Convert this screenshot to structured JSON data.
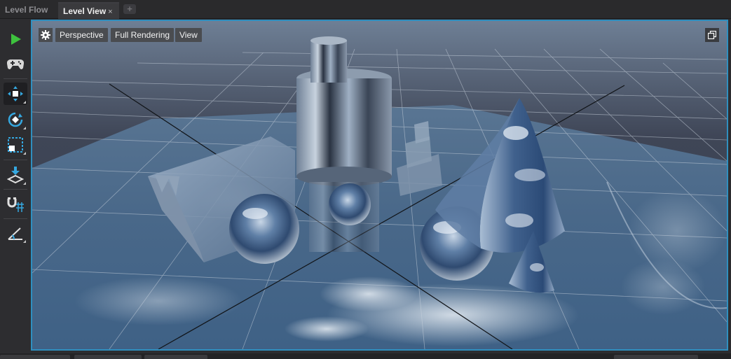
{
  "tabs": [
    {
      "label": "Level Flow"
    },
    {
      "label": "Level View",
      "close": "×"
    }
  ],
  "add_tab": "+",
  "toolbar": {
    "tools": [
      "play-icon",
      "gamepad-icon",
      "move-icon",
      "rotate-icon",
      "scale-select-icon",
      "drop-to-floor-icon",
      "snap-grid-icon",
      "angle-snap-icon"
    ],
    "active": "move-icon"
  },
  "viewport": {
    "buttons": {
      "perspective": "Perspective",
      "rendering": "Full Rendering",
      "view": "View"
    },
    "settings_icon": "gear-icon",
    "maximize_icon": "restore-window-icon"
  },
  "colors": {
    "accent_border": "#2f8fbf",
    "play_green": "#3ec23e",
    "tool_blue": "#35a8e0"
  }
}
